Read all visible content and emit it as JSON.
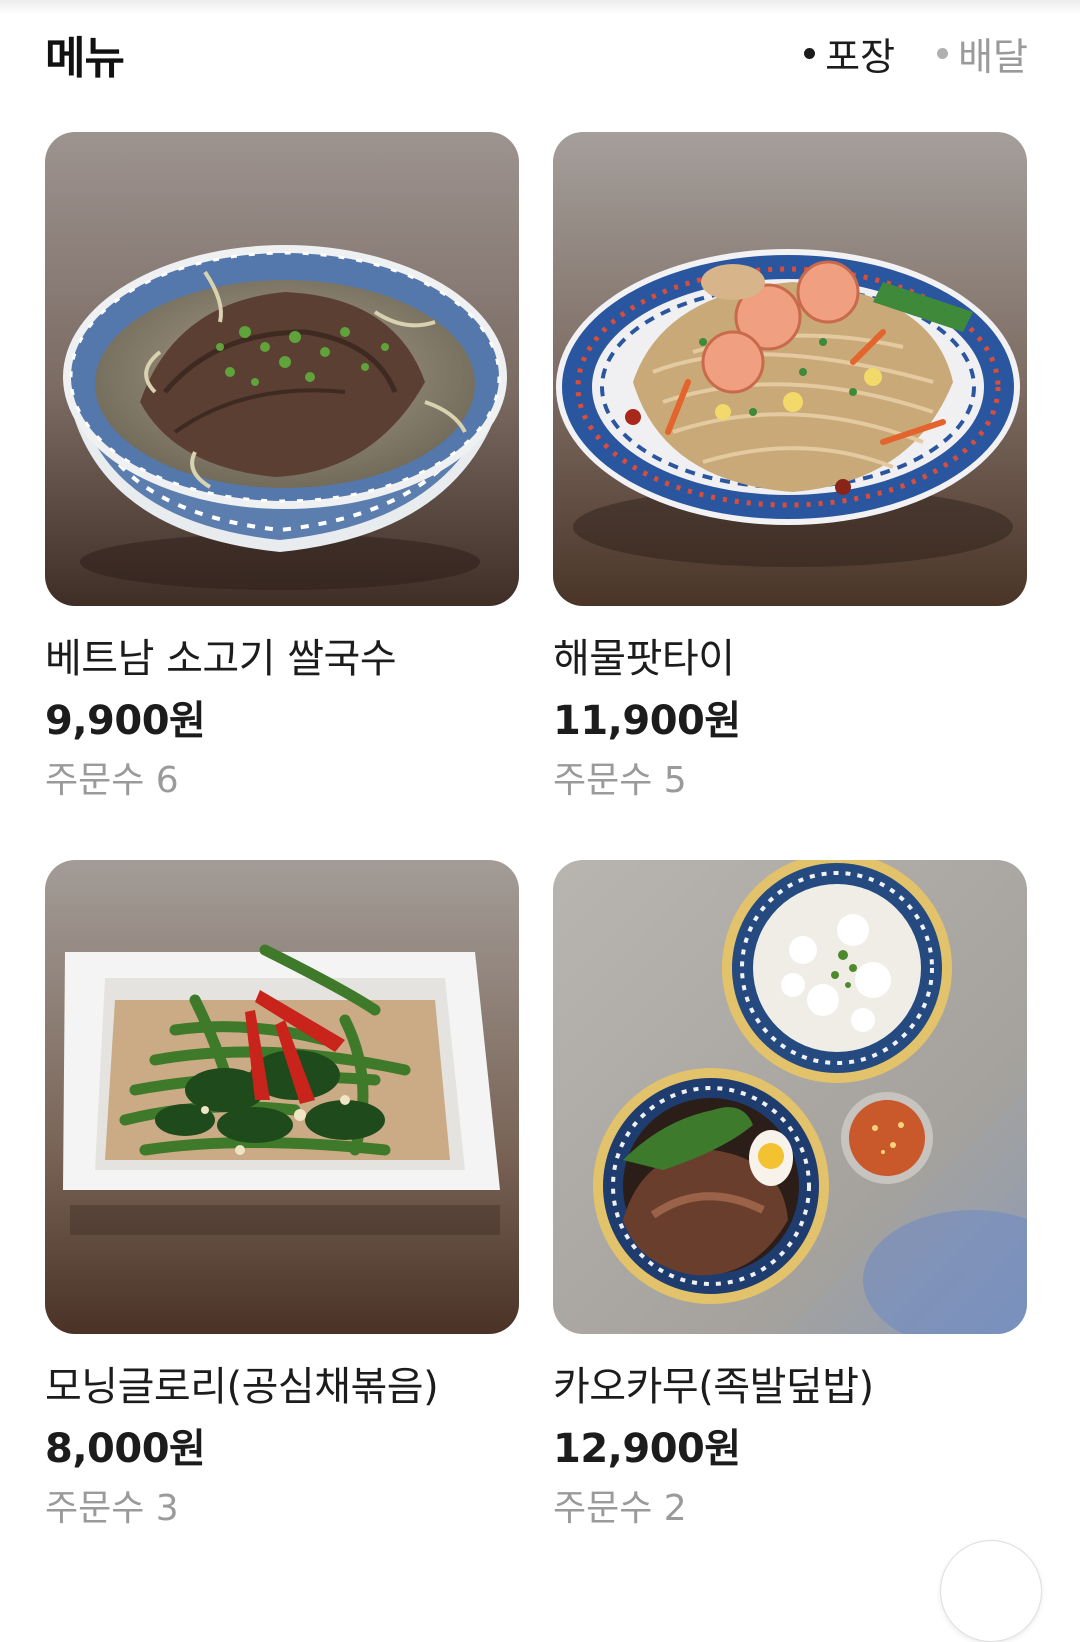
{
  "header": {
    "title": "메뉴",
    "tabs": [
      {
        "label": "포장",
        "active": true
      },
      {
        "label": "배달",
        "active": false
      }
    ]
  },
  "menu": {
    "items": [
      {
        "name": "베트남 소고기 쌀국수",
        "price": "9,900원",
        "orders": "주문수 6",
        "icon": "pho-noodle-image"
      },
      {
        "name": "해물팟타이",
        "price": "11,900원",
        "orders": "주문수 5",
        "icon": "pad-thai-image"
      },
      {
        "name": "모닝글로리(공심채볶음)",
        "price": "8,000원",
        "orders": "주문수 3",
        "icon": "morning-glory-image"
      },
      {
        "name": "카오카무(족발덮밥)",
        "price": "12,900원",
        "orders": "주문수 2",
        "icon": "khao-kha-moo-image"
      }
    ]
  },
  "colors": {
    "text_primary": "#1c1c1c",
    "text_secondary": "#9a9a9a",
    "background": "#ffffff"
  }
}
